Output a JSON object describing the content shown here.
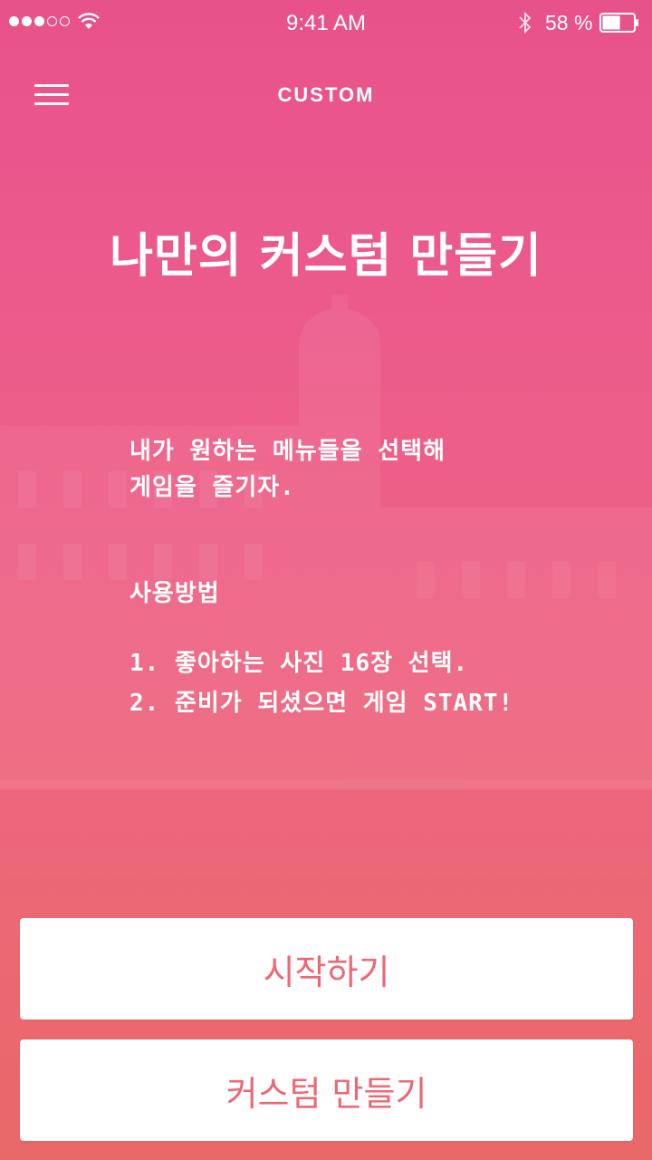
{
  "status_bar": {
    "time": "9:41 AM",
    "battery_percent": "58 %",
    "battery_level": 0.58,
    "signal_bars_filled": 3,
    "signal_bars_total": 5
  },
  "nav": {
    "title": "CUSTOM",
    "menu_icon": "hamburger-menu-icon"
  },
  "main": {
    "title": "나만의 커스텀 만들기",
    "description_lines": [
      "내가 원하는 메뉴들을 선택해",
      "게임을 즐기자."
    ],
    "how_to_title": "사용방법",
    "steps": [
      "1. 좋아하는 사진 16장 선택.",
      "2. 준비가 되셨으면 게임 START!"
    ]
  },
  "buttons": {
    "start_label": "시작하기",
    "custom_label": "커스텀 만들기"
  },
  "colors": {
    "accent": "#ed6774",
    "background_top": "#e8528a",
    "background_bottom": "#e96868"
  }
}
